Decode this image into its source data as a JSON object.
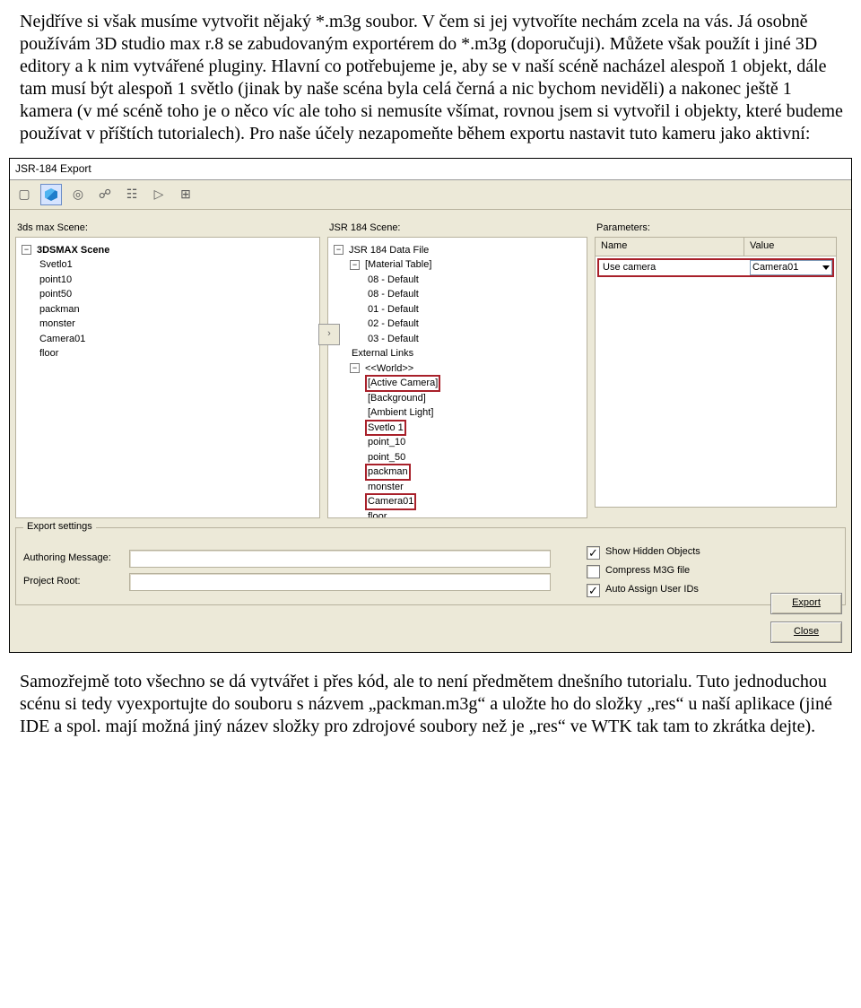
{
  "para": {
    "p1": "Nejdříve si však musíme vytvořit nějaký *.m3g soubor. V čem si jej vytvoříte nechám zcela na vás. Já osobně používám 3D studio max r.8 se zabudovaným exportérem do *.m3g (doporučuji). Můžete však použít i jiné 3D editory a k nim vytvářené pluginy. Hlavní co potřebujeme je, aby se v naší scéně nacházel alespoň 1 objekt, dále tam musí být alespoň 1 světlo (jinak by naše scéna byla celá černá a nic bychom neviděli) a nakonec ještě 1 kamera (v mé scéně toho je o něco víc ale toho si nemusíte všímat, rovnou jsem si vytvořil i objekty, které budeme používat v příštích tutorialech). Pro naše účely nezapomeňte během exportu nastavit tuto kameru jako aktivní:",
    "p2": "Samozřejmě toto všechno se dá vytvářet i přes kód, ale to není předmětem dnešního tutorialu. Tuto jednoduchou scénu si tedy vyexportujte do souboru s názvem „packman.m3g“ a uložte ho do složky „res“ u naší aplikace (jiné IDE a spol. mají možná jiný název složky pro zdrojové soubory než je „res“ ve WTK tak tam to zkrátka dejte)."
  },
  "win": {
    "title": "JSR-184 Export",
    "labels": {
      "left": "3ds max Scene:",
      "mid": "JSR 184 Scene:",
      "right": "Parameters:",
      "paramsName": "Name",
      "paramsValue": "Value",
      "groupTitle": "Export settings",
      "authoring": "Authoring Message:",
      "projectRoot": "Project Root:",
      "showHidden": "Show Hidden Objects",
      "compress": "Compress M3G file",
      "autoAssign": "Auto Assign User IDs",
      "export": "Export",
      "close": "Close"
    },
    "params": {
      "name": "Use camera",
      "value": "Camera01"
    },
    "checkboxes": {
      "showHidden": true,
      "compress": false,
      "autoAssign": true
    },
    "leftTree": {
      "root": "3DSMAX Scene",
      "items": [
        "Svetlo1",
        "point10",
        "point50",
        "packman",
        "monster",
        "Camera01",
        "floor"
      ]
    },
    "midTree": {
      "root": "JSR 184 Data File",
      "mat": {
        "label": "[Material Table]",
        "items": [
          "08 - Default",
          "08 - Default",
          "01 - Default",
          "02 - Default",
          "03 - Default"
        ]
      },
      "ext": "External Links",
      "world": {
        "label": "<<World>>",
        "items": [
          {
            "t": "[Active Camera]",
            "hl": true
          },
          {
            "t": "[Background]",
            "hl": false
          },
          {
            "t": "[Ambient Light]",
            "hl": false
          },
          {
            "t": "Svetlo 1",
            "hl": true
          },
          {
            "t": "point_10",
            "hl": false
          },
          {
            "t": "point_50",
            "hl": false
          },
          {
            "t": "packman",
            "hl": true
          },
          {
            "t": "monster",
            "hl": false
          },
          {
            "t": "Camera01",
            "hl": true
          },
          {
            "t": "floor",
            "hl": false
          }
        ]
      }
    }
  }
}
